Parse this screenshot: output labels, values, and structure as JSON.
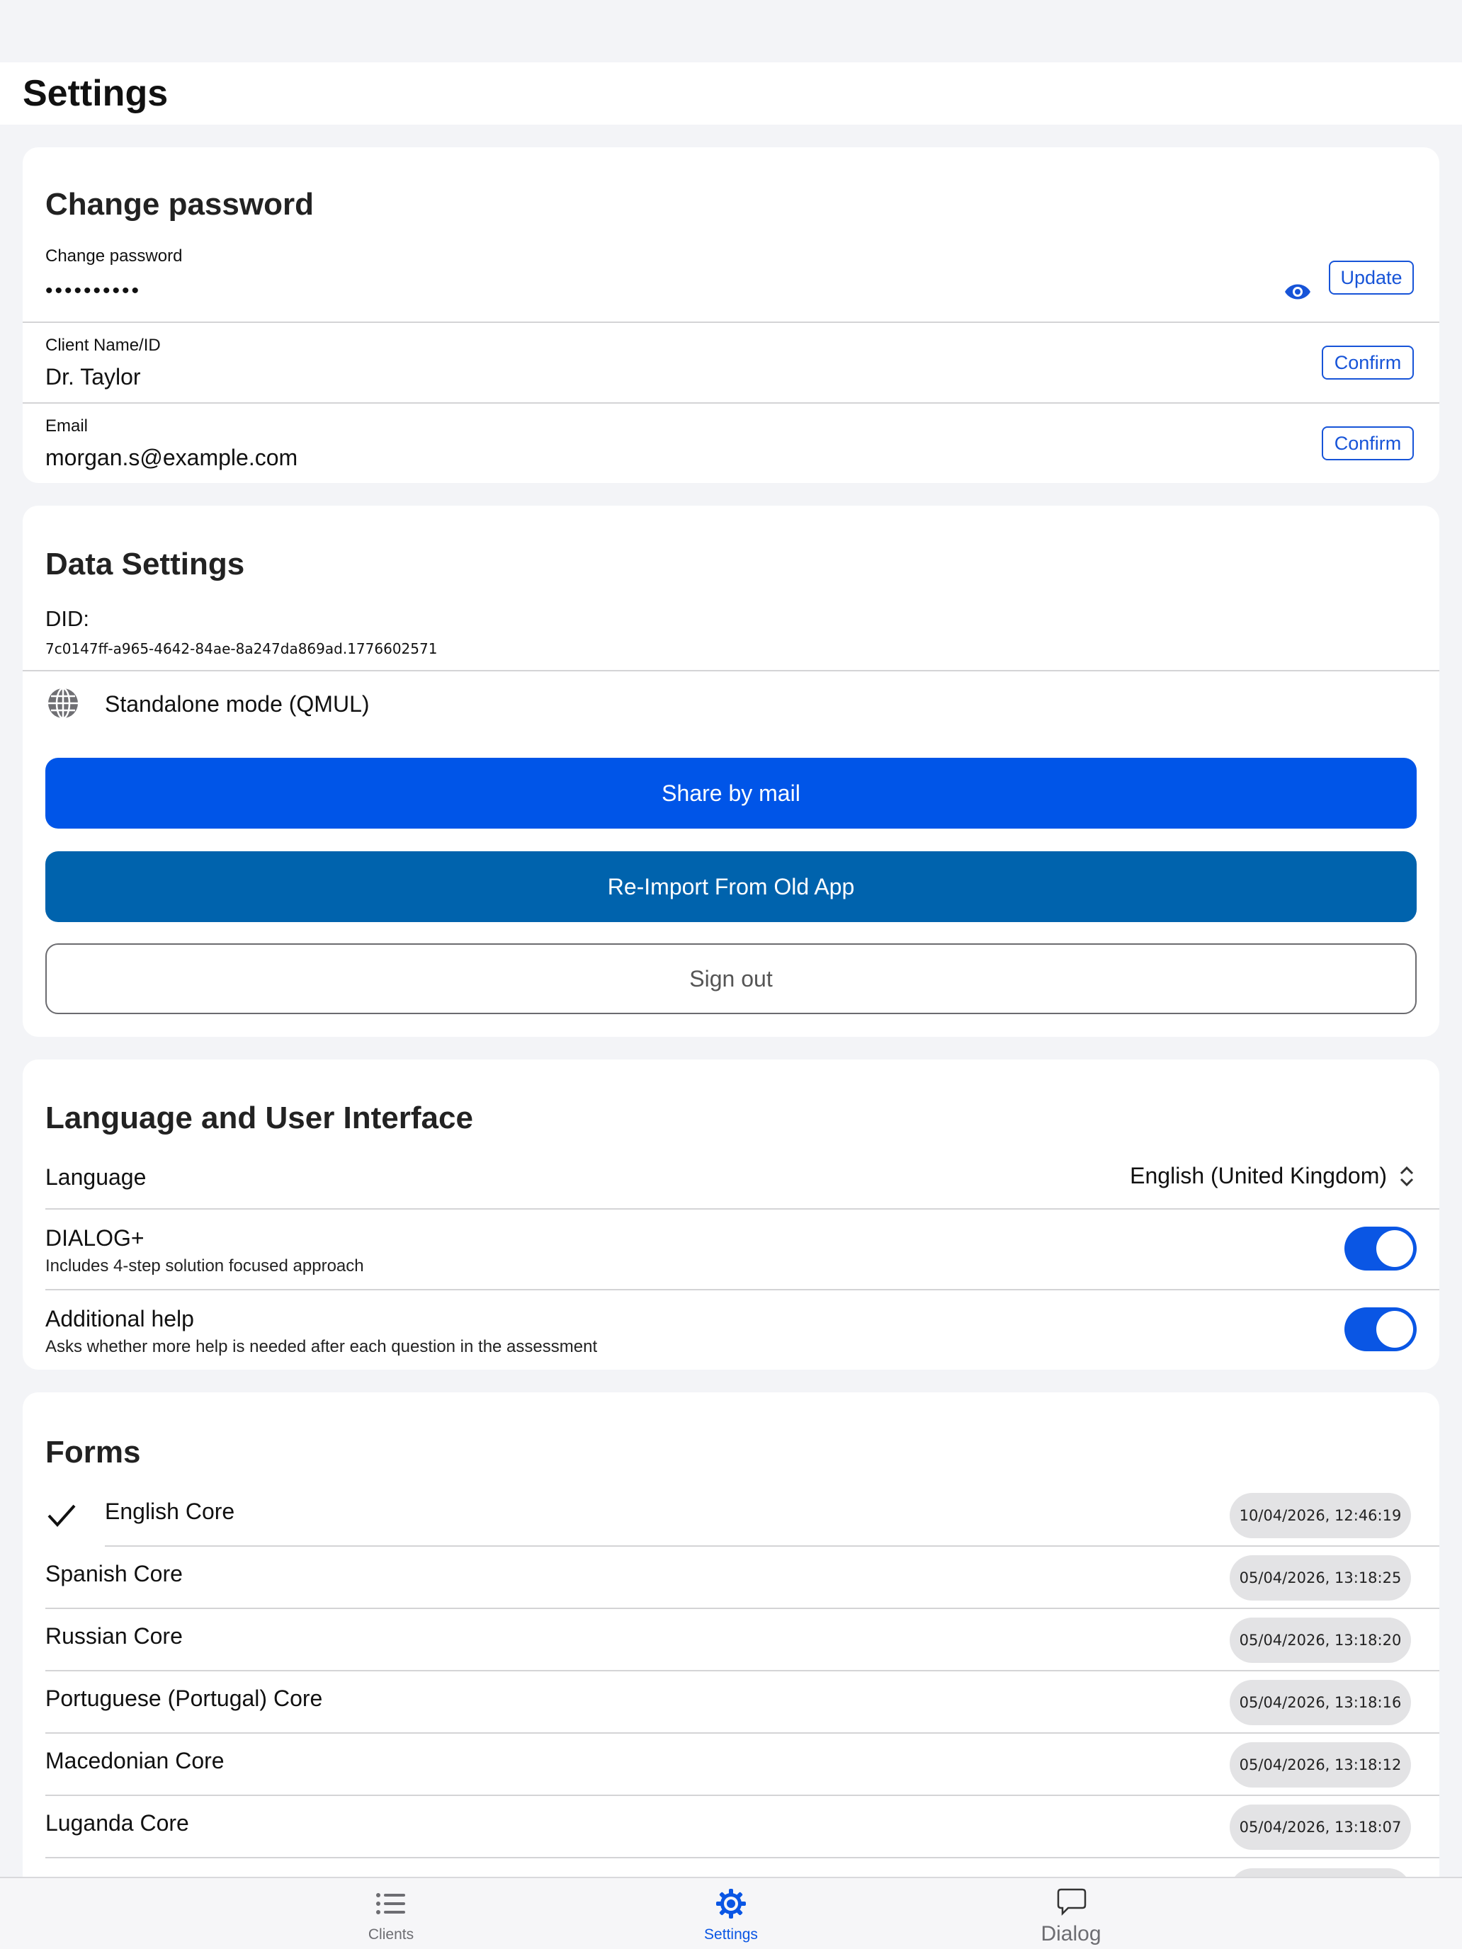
{
  "header": {
    "title": "Settings"
  },
  "password_card": {
    "title": "Change password",
    "password_label": "Change password",
    "password_value": "••••••••••",
    "update_label": "Update",
    "client_label": "Client Name/ID",
    "client_value": "Dr. Taylor",
    "client_confirm": "Confirm",
    "email_label": "Email",
    "email_value": "morgan.s@example.com",
    "email_confirm": "Confirm"
  },
  "data_card": {
    "title": "Data Settings",
    "did_label": "DID:",
    "did_value": "7c0147ff-a965-4642-84ae-8a247da869ad.1776602571",
    "mode_label": "Standalone mode (QMUL)",
    "share_button": "Share by mail",
    "reimport_button": "Re-Import From Old App",
    "signout_button": "Sign out",
    "colors": {
      "share": "#0055e8",
      "reimport": "#0063ad"
    }
  },
  "ui_card": {
    "title": "Language and User Interface",
    "language_label": "Language",
    "language_value": "English (United Kingdom)",
    "dialog_label": "DIALOG+",
    "dialog_desc": "Includes 4-step solution focused approach",
    "dialog_enabled": true,
    "help_label": "Additional help",
    "help_desc": "Asks whether more help is needed after each question in the assessment",
    "help_enabled": true
  },
  "forms_card": {
    "title": "Forms",
    "items": [
      {
        "name": "English Core",
        "date": "10/04/2026, 12:46:19",
        "selected": true
      },
      {
        "name": "Spanish Core",
        "date": "05/04/2026, 13:18:25",
        "selected": false
      },
      {
        "name": "Russian Core",
        "date": "05/04/2026, 13:18:20",
        "selected": false
      },
      {
        "name": "Portuguese (Portugal) Core",
        "date": "05/04/2026, 13:18:16",
        "selected": false
      },
      {
        "name": "Macedonian Core",
        "date": "05/04/2026, 13:18:12",
        "selected": false
      },
      {
        "name": "Luganda Core",
        "date": "05/04/2026, 13:18:07",
        "selected": false
      }
    ]
  },
  "tabbar": {
    "tabs": [
      {
        "label": "Clients",
        "icon": "list-icon",
        "active": false
      },
      {
        "label": "Settings",
        "icon": "gear-icon",
        "active": true
      },
      {
        "label": "Dialog",
        "icon": "chat-bubble-icon",
        "active": false
      }
    ],
    "active_color": "#0a56e4"
  }
}
